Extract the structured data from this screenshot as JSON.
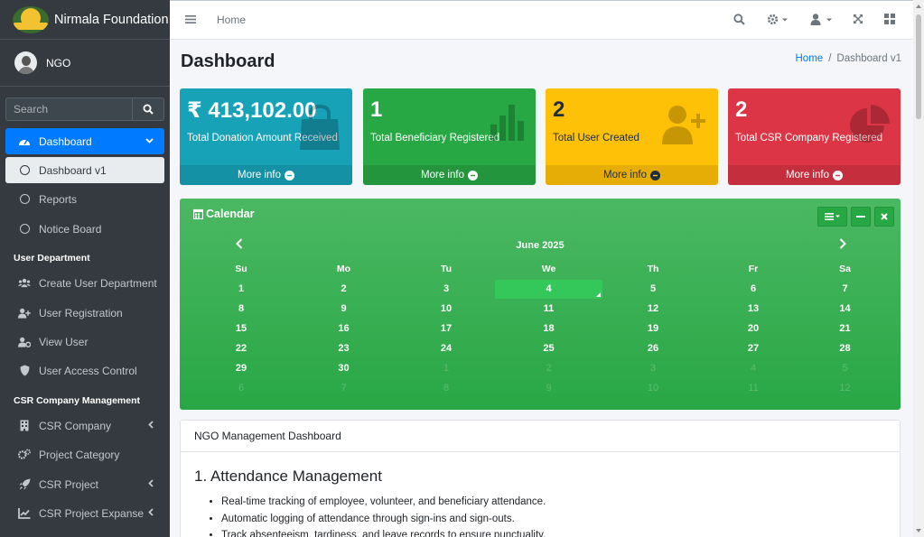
{
  "brand": {
    "name": "Nirmala Foundation",
    "logo_text": "NIRMALA"
  },
  "user": {
    "name": "NGO"
  },
  "search": {
    "placeholder": "Search"
  },
  "sidebar": {
    "dashboard": "Dashboard",
    "dashboard_v1": "Dashboard v1",
    "reports": "Reports",
    "notice_board": "Notice Board",
    "header_user_department": "User Department",
    "create_user_department": "Create User Department",
    "user_registration": "User Registration",
    "view_user": "View User",
    "user_access_control": "User Access Control",
    "header_csr": "CSR Company Management",
    "csr_company": "CSR Company",
    "project_category": "Project Category",
    "csr_project": "CSR Project",
    "csr_project_expanse": "CSR Project Expanse"
  },
  "topbar": {
    "home_link": "Home"
  },
  "page": {
    "title": "Dashboard"
  },
  "breadcrumb": {
    "home": "Home",
    "sep": "/",
    "current": "Dashboard v1"
  },
  "stats": [
    {
      "value": "₹ 413,102.00",
      "label": "Total Donation Amount Received",
      "more": "More info",
      "color": "#17a2b8",
      "icon": "shopping-bag-icon"
    },
    {
      "value": "1",
      "label": "Total Beneficiary Registered",
      "more": "More info",
      "color": "#28a745",
      "icon": "bar-chart-icon"
    },
    {
      "value": "2",
      "label": "Total User Created",
      "more": "More info",
      "color": "#ffc107",
      "icon": "user-plus-icon"
    },
    {
      "value": "2",
      "label": "Total CSR Company Registered",
      "more": "More info",
      "color": "#dc3545",
      "icon": "pie-chart-icon"
    }
  ],
  "calendar": {
    "title": "Calendar",
    "month": "June 2025",
    "weekdays": [
      "Su",
      "Mo",
      "Tu",
      "We",
      "Th",
      "Fr",
      "Sa"
    ],
    "weeks": [
      [
        "1",
        "2",
        "3",
        "4",
        "5",
        "6",
        "7"
      ],
      [
        "8",
        "9",
        "10",
        "11",
        "12",
        "13",
        "14"
      ],
      [
        "15",
        "16",
        "17",
        "18",
        "19",
        "20",
        "21"
      ],
      [
        "22",
        "23",
        "24",
        "25",
        "26",
        "27",
        "28"
      ],
      [
        "29",
        "30",
        "1",
        "2",
        "3",
        "4",
        "5"
      ],
      [
        "6",
        "7",
        "8",
        "9",
        "10",
        "11",
        "12"
      ]
    ],
    "today": "4"
  },
  "mgmt": {
    "header": "NGO Management Dashboard",
    "section_title": "1. Attendance Management",
    "items": [
      "Real-time tracking of employee, volunteer, and beneficiary attendance.",
      "Automatic logging of attendance through sign-ins and sign-outs.",
      "Track absenteeism, tardiness, and leave records to ensure punctuality."
    ]
  }
}
